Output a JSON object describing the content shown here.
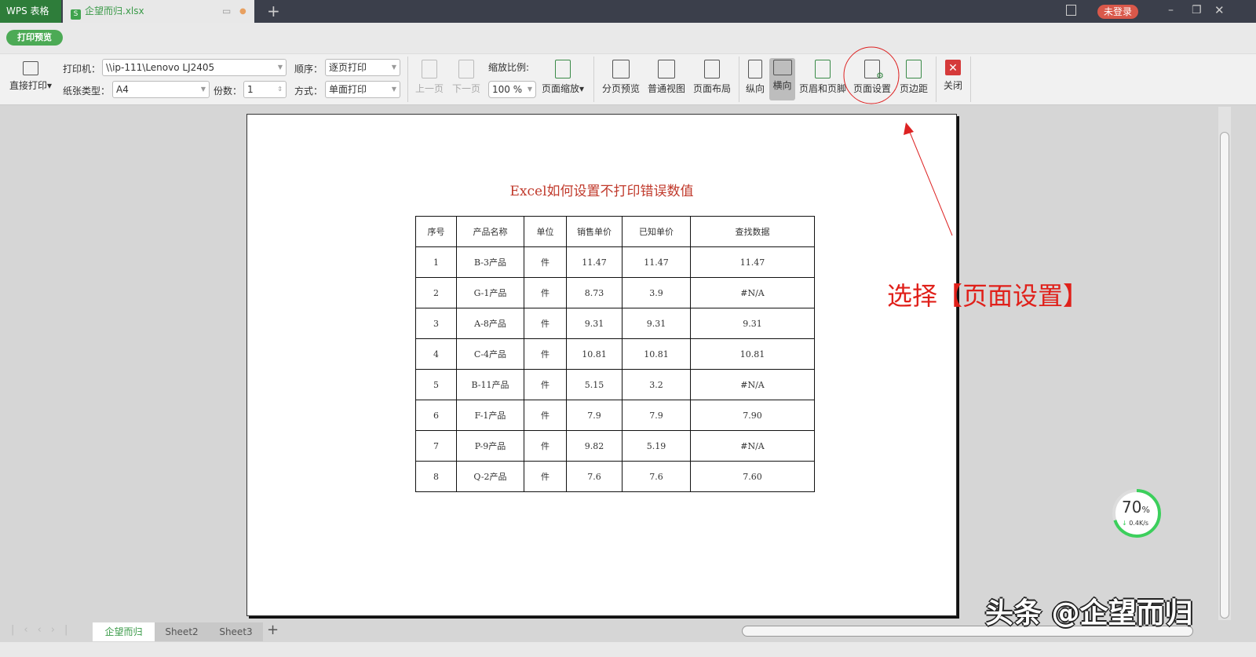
{
  "titlebar": {
    "app_tab": "WPS 表格",
    "file_tab": "企望而归.xlsx",
    "login_button": "未登录",
    "new_tab": "+"
  },
  "mode_button": "打印预览",
  "toolbar": {
    "direct_print": "直接打印",
    "printer_label": "打印机：",
    "printer_value": "\\\\ip-111\\Lenovo LJ2405",
    "paper_label": "纸张类型：",
    "paper_value": "A4",
    "copies_label": "份数：",
    "copies_value": "1",
    "order_label": "顺序：",
    "order_value": "逐页打印",
    "mode_label": "方式：",
    "mode_value": "单面打印",
    "prev_page": "上一页",
    "next_page": "下一页",
    "zoom_label": "缩放比例:",
    "zoom_value": "100 %",
    "page_zoom": "页面缩放",
    "page_break_preview": "分页预览",
    "normal_view": "普通视图",
    "page_layout": "页面布局",
    "portrait": "纵向",
    "landscape": "横向",
    "header_footer": "页眉和页脚",
    "page_setup": "页面设置",
    "margins": "页边距",
    "close": "关闭"
  },
  "document": {
    "title": "Excel如何设置不打印错误数值",
    "headers": [
      "序号",
      "产品名称",
      "单位",
      "销售单价",
      "已知单价",
      "查找数据"
    ],
    "rows": [
      [
        "1",
        "B-3产品",
        "件",
        "11.47",
        "11.47",
        "11.47"
      ],
      [
        "2",
        "G-1产品",
        "件",
        "8.73",
        "3.9",
        "#N/A"
      ],
      [
        "3",
        "A-8产品",
        "件",
        "9.31",
        "9.31",
        "9.31"
      ],
      [
        "4",
        "C-4产品",
        "件",
        "10.81",
        "10.81",
        "10.81"
      ],
      [
        "5",
        "B-11产品",
        "件",
        "5.15",
        "3.2",
        "#N/A"
      ],
      [
        "6",
        "F-1产品",
        "件",
        "7.9",
        "7.9",
        "7.90"
      ],
      [
        "7",
        "P-9产品",
        "件",
        "9.82",
        "5.19",
        "#N/A"
      ],
      [
        "8",
        "Q-2产品",
        "件",
        "7.6",
        "7.6",
        "7.60"
      ]
    ]
  },
  "annotation": "选择【页面设置】",
  "sheets": [
    "企望而归",
    "Sheet2",
    "Sheet3"
  ],
  "add_sheet": "+",
  "speed_widget": {
    "percent": "70",
    "unit": "%",
    "speed": "0.4K/s",
    "progress": 0.7
  },
  "watermark": "头条 @企望而归"
}
